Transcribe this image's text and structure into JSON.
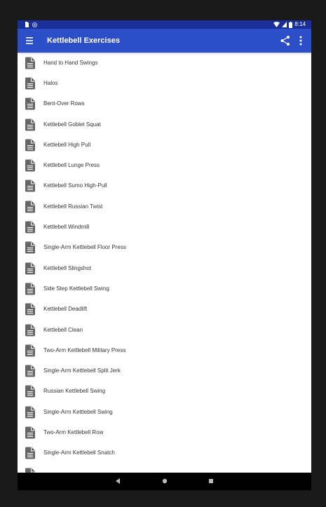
{
  "status_bar": {
    "time": "8:14"
  },
  "app_bar": {
    "title": "Kettlebell Exercises",
    "menu_icon": "menu-icon",
    "share_icon": "share-icon",
    "more_icon": "more-vert-icon"
  },
  "colors": {
    "status_bar": "#1a2f9a",
    "app_bar": "#2d4ec9",
    "doc_icon": "#666666"
  },
  "list": {
    "item_icon": "document-icon",
    "items": [
      "Hand to Hand Swings",
      "Halos",
      "Bent-Over Rows",
      "Kettlebell Goblet Squat",
      "Kettlebell High Pull",
      "Kettlebell Lunge Press",
      "Kettlebell Sumo High-Pull",
      "Kettlebell Russian Twist",
      "Kettlebell Windmill",
      "Single-Arm Kettlebell Floor Press",
      "Kettlebell Slingshot",
      "Side Step Kettlebell Swing",
      "Kettlebell Deadlift",
      "Kettlebell Clean",
      "Two-Arm Kettlebell Military Press",
      "Single-Arm Kettlebell Split Jerk",
      "Russian Kettlebell Swing",
      "Single-Arm Kettlebell Swing",
      "Two-Arm Kettlebell Row",
      "Single-Arm Kettlebell Snatch",
      ""
    ]
  },
  "nav_bar": {
    "back_icon": "back-icon",
    "home_icon": "home-icon",
    "recents_icon": "recents-icon"
  }
}
